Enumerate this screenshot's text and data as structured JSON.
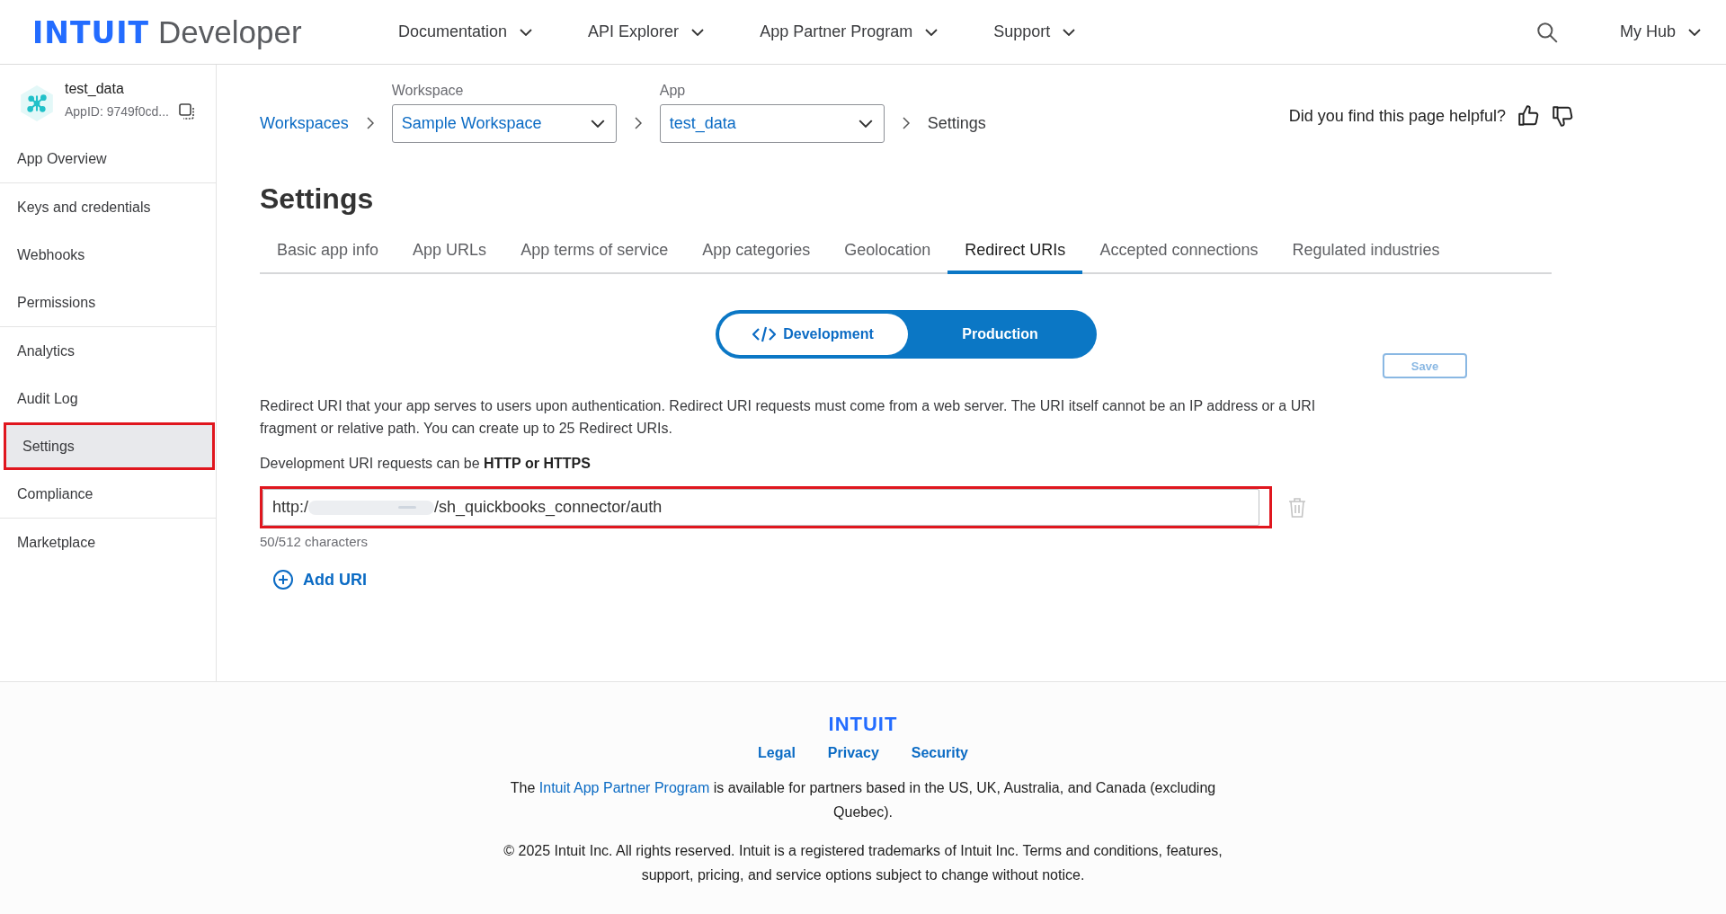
{
  "header": {
    "logo_brand": "INTUIT",
    "logo_product": "Developer",
    "nav": [
      {
        "label": "Documentation"
      },
      {
        "label": "API Explorer"
      },
      {
        "label": "App Partner Program"
      },
      {
        "label": "Support"
      }
    ],
    "account": "My Hub"
  },
  "sidebar": {
    "app_name": "test_data",
    "app_id": "AppID: 9749f0cd...",
    "groups": [
      [
        {
          "label": "App Overview",
          "selected": false,
          "highlighted": false
        }
      ],
      [
        {
          "label": "Keys and credentials",
          "selected": false,
          "highlighted": false
        },
        {
          "label": "Webhooks",
          "selected": false,
          "highlighted": false
        },
        {
          "label": "Permissions",
          "selected": false,
          "highlighted": false
        }
      ],
      [
        {
          "label": "Analytics",
          "selected": false,
          "highlighted": false
        },
        {
          "label": "Audit Log",
          "selected": false,
          "highlighted": false
        },
        {
          "label": "Settings",
          "selected": true,
          "highlighted": true
        },
        {
          "label": "Compliance",
          "selected": false,
          "highlighted": false
        }
      ],
      [
        {
          "label": "Marketplace",
          "selected": false,
          "highlighted": false
        }
      ]
    ]
  },
  "breadcrumb": {
    "root": "Workspaces",
    "workspace_label": "Workspace",
    "workspace": "Sample Workspace",
    "app_label": "App",
    "app": "test_data",
    "current": "Settings"
  },
  "feedback": "Did you find this page helpful?",
  "title": "Settings",
  "tabs": [
    {
      "label": "Basic app info",
      "selected": false
    },
    {
      "label": "App URLs",
      "selected": false
    },
    {
      "label": "App terms of service",
      "selected": false
    },
    {
      "label": "App categories",
      "selected": false
    },
    {
      "label": "Geolocation",
      "selected": false
    },
    {
      "label": "Redirect URIs",
      "selected": true
    },
    {
      "label": "Accepted connections",
      "selected": false
    },
    {
      "label": "Regulated industries",
      "selected": false
    }
  ],
  "environment": [
    {
      "label": "Development",
      "selected": true
    },
    {
      "label": "Production",
      "selected": false
    }
  ],
  "save": {
    "label": "Save",
    "disabled": true
  },
  "description": "Redirect URI that your app serves to users upon authentication. Redirect URI requests must come from a web server. The URI itself cannot be an IP address or a URI fragment or relative path. You can create up to 25 Redirect URIs.",
  "protocol_note": "Development URI requests can be **HTTP or HTTPS**",
  "uris": [
    {
      "value_start": "http:/",
      "value_end": "/sh_quickbooks_connector/auth",
      "redacted": true,
      "highlighted": true,
      "count": "50/512 characters"
    }
  ],
  "add_uri": "Add URI",
  "footer": {
    "logo": "INTUIT",
    "links": [
      "Legal",
      "Privacy",
      "Security"
    ],
    "availability_pre": "The",
    "availability_link": "Intuit App Partner Program",
    "availability_post": "is available for partners based in the US, UK, Australia, and Canada (excluding Quebec).",
    "copyright": "© 2025 Intuit Inc. All rights reserved. Intuit is a registered trademarks of Intuit Inc. Terms and conditions, features, support, pricing, and service options subject to change without notice."
  }
}
